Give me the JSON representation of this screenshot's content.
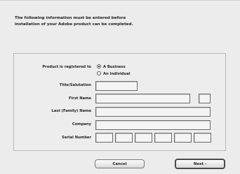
{
  "intro": {
    "line1": "The following information must be entered before",
    "line2": "installation of your Adobe product can be completed."
  },
  "registration": {
    "label": "Product is registered to",
    "options": [
      "A Business",
      "An Individual"
    ],
    "selected": "A Business"
  },
  "form": {
    "title_label": "Title/Salutation",
    "first_name_label": "First Name",
    "last_name_label": "Last (Family) Name",
    "company_label": "Company",
    "serial_label": "Serial Number"
  },
  "buttons": {
    "cancel": "Cancel",
    "next": "Next ›"
  }
}
